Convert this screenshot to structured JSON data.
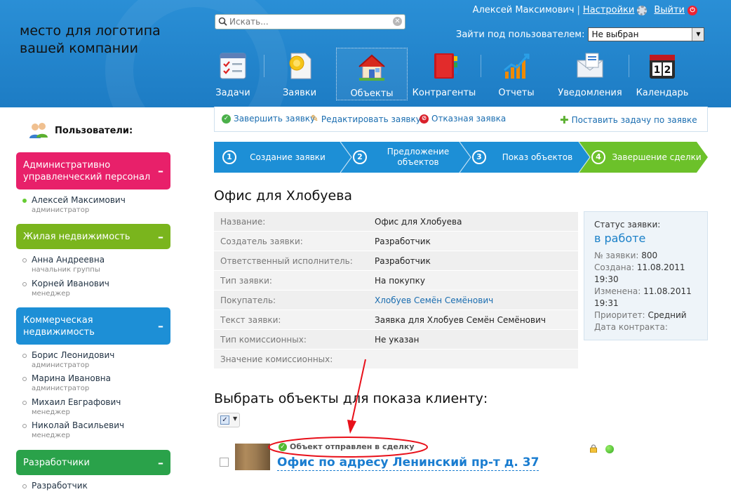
{
  "header": {
    "logo_text": "место для логотипа вашей компании",
    "search": {
      "placeholder": "Искать...",
      "value": ""
    },
    "user_name": "Алексей Максимович",
    "settings_label": "Настройки",
    "logout_label": "Выйти",
    "impersonate_label": "Зайти под пользователем:",
    "impersonate_value": "Не выбран",
    "nav": [
      {
        "label": "Задачи",
        "icon": "tasks-icon"
      },
      {
        "label": "Заявки",
        "icon": "requests-icon"
      },
      {
        "label": "Объекты",
        "icon": "house-icon",
        "active": true
      },
      {
        "label": "Контрагенты",
        "icon": "contacts-book-icon"
      },
      {
        "label": "Отчеты",
        "icon": "chart-icon"
      },
      {
        "label": "Уведомления",
        "icon": "envelope-icon"
      },
      {
        "label": "Календарь",
        "icon": "calendar-icon"
      }
    ]
  },
  "sidebar": {
    "title": "Пользователи:",
    "groups": [
      {
        "name": "Административно управленческий персонал",
        "color": "#e8206a",
        "members": [
          {
            "name": "Алексей Максимович",
            "role": "администратор",
            "online": true
          }
        ]
      },
      {
        "name": "Жилая недвижимость",
        "color": "#7ab51d",
        "members": [
          {
            "name": "Анна Андреевна",
            "role": "начальник группы"
          },
          {
            "name": "Корней Иванович",
            "role": "менеджер"
          }
        ]
      },
      {
        "name": "Коммерческая недвижимость",
        "color": "#1d8fd6",
        "members": [
          {
            "name": "Борис Леонидович",
            "role": "администратор"
          },
          {
            "name": "Марина Ивановна",
            "role": "администратор"
          },
          {
            "name": "Михаил Евграфович",
            "role": "менеджер"
          },
          {
            "name": "Николай Васильевич",
            "role": "менеджер"
          }
        ]
      },
      {
        "name": "Разработчики",
        "color": "#2aa24a",
        "members": [
          {
            "name": "Разработчик",
            "role": ""
          }
        ]
      }
    ]
  },
  "actions": {
    "complete": "Завершить заявку",
    "edit": "Редактировать заявку",
    "reject": "Отказная заявка",
    "add_task": "Поставить задачу по заявке"
  },
  "steps": [
    {
      "num": "1",
      "label": "Создание заявки"
    },
    {
      "num": "2",
      "label": "Предложение объектов"
    },
    {
      "num": "3",
      "label": "Показ объектов"
    },
    {
      "num": "4",
      "label": "Завершение сделки",
      "active": true
    }
  ],
  "request": {
    "title": "Офис для Хлобуева",
    "fields": [
      {
        "label": "Название:",
        "value": "Офис для Хлобуева"
      },
      {
        "label": "Создатель заявки:",
        "value": "Разработчик"
      },
      {
        "label": "Ответственный исполнитель:",
        "value": "Разработчик"
      },
      {
        "label": "Тип заявки:",
        "value": "На покупку"
      },
      {
        "label": "Покупатель:",
        "value": "Хлобуев Семён Семёнович"
      },
      {
        "label": "Текст заявки:",
        "value": "Заявка для Хлобуев Семён Семёнович"
      },
      {
        "label": "Тип комиссионных:",
        "value": "Не указан"
      },
      {
        "label": "Значение комиссионных:",
        "value": ""
      }
    ]
  },
  "status": {
    "title": "Статус заявки:",
    "value": "в работе",
    "number_label": "№ заявки:",
    "number": "800",
    "created_label": "Создана:",
    "created": "11.08.2011",
    "created_time": "19:30",
    "changed_label": "Изменена:",
    "changed": "11.08.2011",
    "changed_time": "19:31",
    "priority_label": "Приоритет:",
    "priority": "Средний",
    "contract_label": "Дата контракта:"
  },
  "objects": {
    "title": "Выбрать объекты для показа клиенту:",
    "items": [
      {
        "badge": "Объект отправлен в сделку",
        "name": "Офис по адресу Ленинский пр-т д. 37"
      }
    ]
  },
  "colors": {
    "header_blue": "#1d7cc4",
    "step_blue": "#1d8fd6",
    "step_green": "#6cc12a",
    "annotation_red": "#e8101a"
  }
}
